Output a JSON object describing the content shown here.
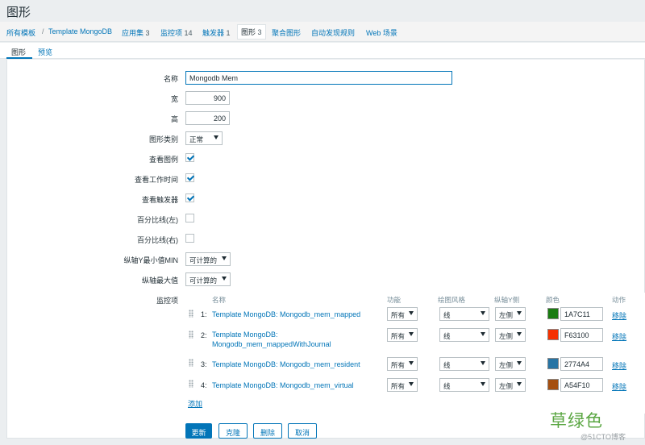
{
  "page": {
    "title": "图形"
  },
  "breadcrumbs": [
    {
      "label": "所有模板"
    },
    {
      "label": "Template MongoDB"
    },
    {
      "label": "应用集",
      "count": "3"
    },
    {
      "label": "监控项",
      "count": "14"
    },
    {
      "label": "触发器",
      "count": "1"
    },
    {
      "label": "图形",
      "count": "3"
    },
    {
      "label": "聚合图形"
    },
    {
      "label": "自动发现规则"
    },
    {
      "label": "Web 场景"
    }
  ],
  "tabs": [
    {
      "label": "图形"
    },
    {
      "label": "预览"
    }
  ],
  "form": {
    "name_label": "名称",
    "name_value": "Mongodb Mem",
    "width_label": "宽",
    "width_value": "900",
    "height_label": "高",
    "height_value": "200",
    "graph_type_label": "图形类别",
    "graph_type_value": "正常",
    "show_legend_label": "查看图例",
    "show_legend": true,
    "show_working_time_label": "查看工作时间",
    "show_working_time": true,
    "show_triggers_label": "查看触发器",
    "show_triggers": true,
    "percentile_left_label": "百分比线(左)",
    "percentile_left": false,
    "percentile_right_label": "百分比线(右)",
    "percentile_right": false,
    "ymin_label": "纵轴Y最小值MIN",
    "ymin_value": "可计算的",
    "ymax_label": "纵轴最大值",
    "ymax_value": "可计算的",
    "items_label": "监控项"
  },
  "items_table": {
    "headers": {
      "name": "名称",
      "func": "功能",
      "style": "绘图风格",
      "yaxis": "纵轴Y侧",
      "color": "颜色",
      "action": "动作"
    },
    "rows": [
      {
        "index": "1:",
        "name": "Template MongoDB: Mongodb_mem_mapped",
        "func": "所有",
        "style": "线",
        "yaxis": "左侧",
        "color": "1A7C11",
        "action": "移除"
      },
      {
        "index": "2:",
        "name": "Template MongoDB:\nMongodb_mem_mappedWithJournal",
        "func": "所有",
        "style": "线",
        "yaxis": "左侧",
        "color": "F63100",
        "action": "移除"
      },
      {
        "index": "3:",
        "name": "Template MongoDB: Mongodb_mem_resident",
        "func": "所有",
        "style": "线",
        "yaxis": "左侧",
        "color": "2774A4",
        "action": "移除"
      },
      {
        "index": "4:",
        "name": "Template MongoDB: Mongodb_mem_virtual",
        "func": "所有",
        "style": "线",
        "yaxis": "左侧",
        "color": "A54F10",
        "action": "移除"
      }
    ],
    "add_label": "添加"
  },
  "buttons": {
    "update": "更新",
    "clone": "克隆",
    "delete": "删除",
    "cancel": "取消"
  },
  "watermark": {
    "text": "草绿色",
    "site": "@51CTO博客"
  }
}
